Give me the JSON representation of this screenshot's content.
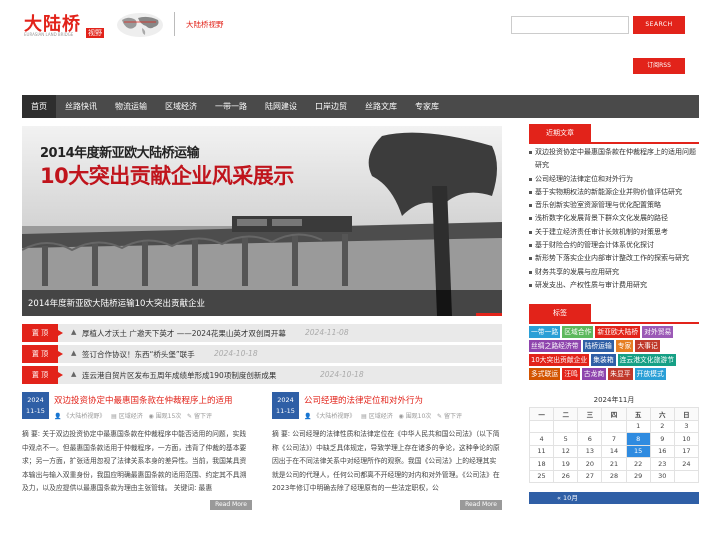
{
  "header": {
    "logo_text": "大陆桥",
    "logo_badge": "视野",
    "logo_en": "EURASIAN LAND BRIDGE",
    "tagline": "大陆桥视野",
    "search_button": "SEARCH",
    "search_placeholder": "",
    "rss_button": "订阅RSS"
  },
  "nav": [
    "首页",
    "丝路快讯",
    "物流运输",
    "区域经济",
    "一带一路",
    "陆网建设",
    "口岸边贸",
    "丝路文库",
    "专家库"
  ],
  "slider": {
    "title1": "2014年度新亚欧大陆桥运输",
    "title2": "10大突出贡献企业风采展示",
    "caption": "2014年度新亚欧大陆桥运输10大突出贡献企业"
  },
  "sticky_posts": [
    {
      "tag": "置 顶",
      "title": "厚植人才沃土 广邀天下英才 ——2024花果山英才双创周开幕",
      "date": "2024-11-08"
    },
    {
      "tag": "置 顶",
      "title": "签订合作协议！东西“桥头堡”联手",
      "date": "2024-10-18"
    },
    {
      "tag": "置 顶",
      "title": "连云港自贸片区发布五周年成绩单形成190项制度创新成果",
      "date": "2024-10-18"
    }
  ],
  "posts": [
    {
      "year": "2024",
      "day": "11-15",
      "title": "双边投资协定中最惠国条款在仲裁程序上的适用",
      "meta": [
        "《大陆桥视野》",
        "区域经济",
        "围观15次",
        "留下评"
      ],
      "body": "摘 要: 关于双边投资协定中最惠国条款在仲裁程序中能否适用的问题，实践中观点不一。但最惠国条款适用于仲裁程序，一方面，违背了仲裁的基本要求；另一方面，扩张适用忽视了法律关系本身的差异性。当前，我国某具资本输出与输入双重身份，我国应明确最惠国条款的适用范围、约定其不具溯及力，以及应提供以最惠国条款为理由主张管辖。 关键词: 最惠",
      "readmore": "Read More"
    },
    {
      "year": "2024",
      "day": "11-15",
      "title": "公司经理的法律定位和对外行为",
      "meta": [
        "《大陆桥视野》",
        "区域经济",
        "围观10次",
        "留下评"
      ],
      "body": "摘 要: 公司经理的法律性质和法律定位在《中华人民共和国公司法》（以下简称《公司法》）中缺乏具体规定，导致学理上存在诸多的争论，这种争论的原因出于在不同法律关系中对经理所作的观察。我国《公司法》上的经理其实就是公司的代理人，任何公司都离不开经理的对内和对外管理。《公司法》在2023年修订中明确去除了经理原有的一些法定职权，公",
      "readmore": "Read More"
    }
  ],
  "sidebar": {
    "recent_title": "近期文章",
    "recent": [
      "双边投资协定中最惠国条款在仲裁程序上的适用问题研究",
      "公司经理的法律定位和对外行为",
      "基于实物期权法的新能源企业并购价值评估研究",
      "音乐创新实验室资源管理与优化配置策略",
      "浅析数字化发展背景下群众文化发展的路径",
      "关于建立经济责任审计长效机制的对策思考",
      "基于财险合约的管理会计体系优化探讨",
      "新形势下落实企业内部审计整改工作的探索与研究",
      "财务共享的发展与应用研究",
      "研发支出、产权性质与审计费用研究"
    ],
    "tags_title": "标签",
    "tags": [
      {
        "t": "一带一路",
        "c": "#2a9fd6"
      },
      {
        "t": "区域合作",
        "c": "#5cb85c"
      },
      {
        "t": "新亚欧大陆桥",
        "c": "#e2231a"
      },
      {
        "t": "对外贸易",
        "c": "#9b59b6"
      },
      {
        "t": "丝绸之路经济带",
        "c": "#8e44ad"
      },
      {
        "t": "陆桥运输",
        "c": "#2f5fa6"
      },
      {
        "t": "专家",
        "c": "#e67e22"
      },
      {
        "t": "大事记",
        "c": "#c0392b"
      },
      {
        "t": "10大突出贡献企业",
        "c": "#e2231a"
      },
      {
        "t": "集装箱",
        "c": "#2f5fa6"
      },
      {
        "t": "连云港文化旅游节",
        "c": "#16a085"
      },
      {
        "t": "多式联运",
        "c": "#d35400"
      },
      {
        "t": "汪鸣",
        "c": "#e2231a"
      },
      {
        "t": "古龙商",
        "c": "#8e44ad"
      },
      {
        "t": "朱显平",
        "c": "#c0392b"
      },
      {
        "t": "开放模式",
        "c": "#2a9fd6"
      }
    ],
    "calendar": {
      "caption": "2024年11月",
      "weekdays": [
        "一",
        "二",
        "三",
        "四",
        "五",
        "六",
        "日"
      ],
      "rows": [
        [
          "",
          "",
          "",
          "",
          "1",
          "2",
          "3"
        ],
        [
          "4",
          "5",
          "6",
          "7",
          "8",
          "9",
          "10"
        ],
        [
          "11",
          "12",
          "13",
          "14",
          "15",
          "16",
          "17"
        ],
        [
          "18",
          "19",
          "20",
          "21",
          "22",
          "23",
          "24"
        ],
        [
          "25",
          "26",
          "27",
          "28",
          "29",
          "30",
          ""
        ]
      ],
      "prev": "« 10月"
    }
  }
}
